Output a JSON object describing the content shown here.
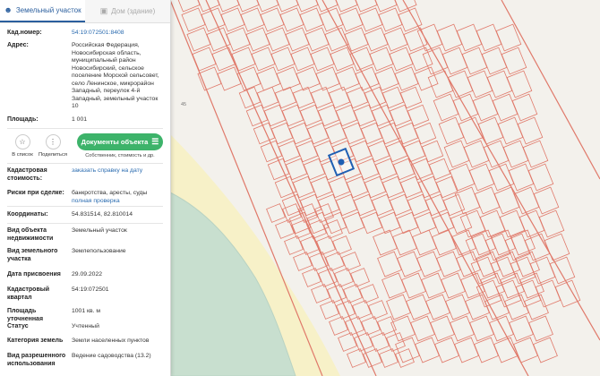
{
  "tabs": [
    {
      "label": "Земельный участок",
      "active": true
    },
    {
      "label": "Дом (здание)",
      "active": false
    }
  ],
  "top_fields": {
    "cadnum_label": "Кад.номер:",
    "cadnum_value": "54:19:072501:8408",
    "address_label": "Адрес:",
    "address_value": "Российская Федерация, Новосибирская область, муниципальный район Новосибирский, сельское поселение Морской сельсовет, село Ленинское, микрорайон Западный, переулок 4-й Западный, земельный участок 10",
    "area_label": "Площадь:",
    "area_value": "1 001"
  },
  "actions": {
    "to_list": "В список",
    "share": "Поделиться",
    "docs_button": "Документы объекта",
    "docs_sub": "Собственник, стоимость и др."
  },
  "cad_cost": {
    "label": "Кадастровая стоимость:",
    "link": "заказать справку на дату"
  },
  "risks": {
    "label": "Риски при сделке:",
    "text": "банкротства, аресты, суды",
    "link": "полная проверка"
  },
  "coords": {
    "label": "Координаты:",
    "value": "54.831514, 82.810014"
  },
  "details": [
    {
      "label": "Вид объекта недвижимости",
      "value": "Земельный участок"
    },
    {
      "label": "Вид земельного участка",
      "value": "Землепользование"
    },
    {
      "label": "Дата присвоения",
      "value": "29.09.2022"
    },
    {
      "label": "Кадастровый квартал",
      "value": "54:19:072501"
    },
    {
      "label": "Площадь уточненная",
      "value": "1001 кв. м"
    },
    {
      "label": "Статус",
      "value": "Учтенный"
    },
    {
      "label": "Категория земель",
      "value": "Земли населенных пунктов"
    },
    {
      "label": "Вид разрешенного использования",
      "value": "Ведение садоводства (13.2)"
    }
  ],
  "map": {
    "label_45": "45",
    "parcel_color": "#e0796a",
    "selected_color": "#1f5fb3",
    "river_color": "#c8dfcf",
    "sand_color": "#f7f1c8"
  },
  "icons": {
    "land": "user-pin-icon",
    "house": "building-icon",
    "star": "star-icon",
    "share": "share-icon",
    "doc": "document-icon"
  }
}
